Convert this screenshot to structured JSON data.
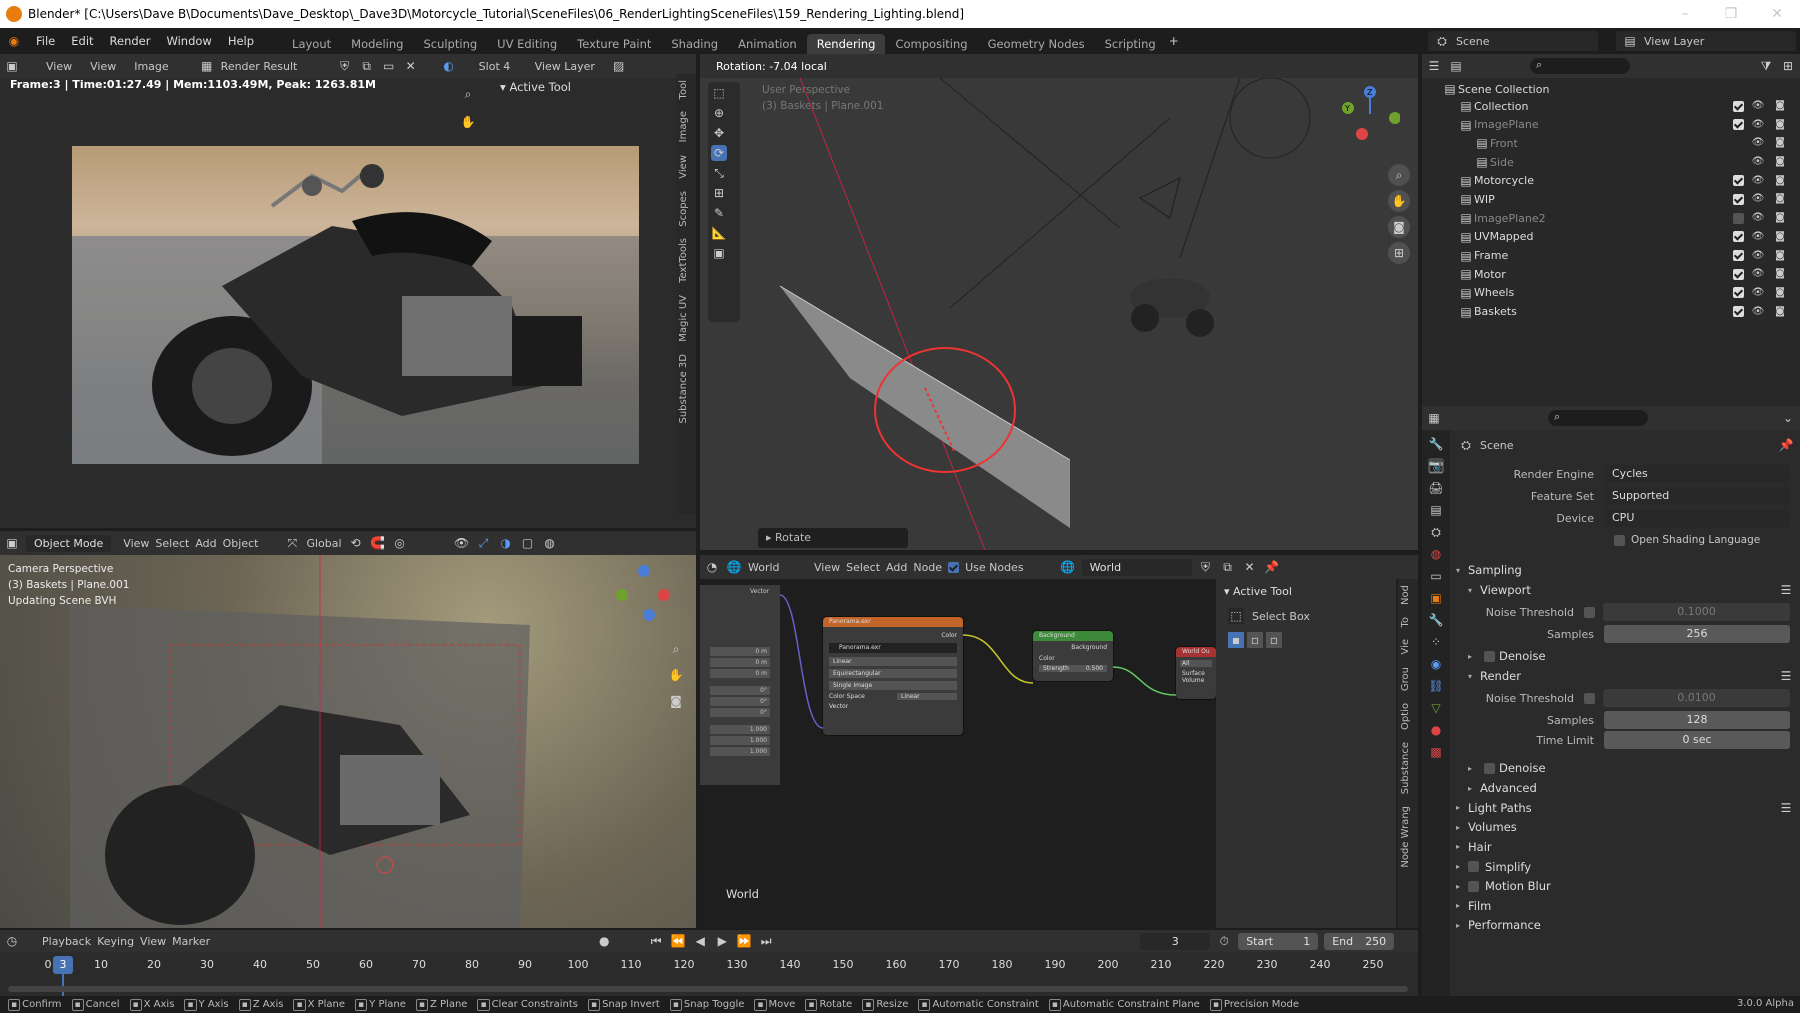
{
  "window": {
    "title": "Blender* [C:\\Users\\Dave B\\Documents\\Dave_Desktop\\_Dave3D\\Motorcycle_Tutorial\\SceneFiles\\06_RenderLightingSceneFiles\\159_Rendering_Lighting.blend]"
  },
  "menu": [
    "File",
    "Edit",
    "Render",
    "Window",
    "Help"
  ],
  "workspaces": [
    {
      "label": "Layout",
      "active": false
    },
    {
      "label": "Modeling",
      "active": false
    },
    {
      "label": "Sculpting",
      "active": false
    },
    {
      "label": "UV Editing",
      "active": false
    },
    {
      "label": "Texture Paint",
      "active": false
    },
    {
      "label": "Shading",
      "active": false
    },
    {
      "label": "Animation",
      "active": false
    },
    {
      "label": "Rendering",
      "active": true
    },
    {
      "label": "Compositing",
      "active": false
    },
    {
      "label": "Geometry Nodes",
      "active": false
    },
    {
      "label": "Scripting",
      "active": false
    }
  ],
  "top_right": {
    "scene": "Scene",
    "view_layer": "View Layer"
  },
  "image_editor": {
    "menu": [
      "View",
      "View",
      "Image"
    ],
    "image_name": "Render Result",
    "slot": "Slot 4",
    "view_layer": "View Layer",
    "info": "Frame:3 | Time:01:27.49 | Mem:1103.49M, Peak: 1263.81M",
    "active_tool": "Active Tool",
    "tabs": [
      "Tool",
      "Image",
      "View",
      "Scopes",
      "TextTools",
      "Magic UV",
      "Substance 3D"
    ]
  },
  "viewport_top": {
    "header": "Rotation: -7.04 local",
    "label1": "User Perspective",
    "label2": "(3) Baskets | Plane.001",
    "operator": "Rotate"
  },
  "viewport_bottom": {
    "mode": "Object Mode",
    "menu": [
      "View",
      "Select",
      "Add",
      "Object"
    ],
    "orientation": "Global",
    "label1": "Camera Perspective",
    "label2": "(3) Baskets | Plane.001",
    "label3": "Updating Scene BVH"
  },
  "node_editor": {
    "type": "World",
    "menu": [
      "View",
      "Select",
      "Add",
      "Node"
    ],
    "use_nodes": "Use Nodes",
    "world_name": "World",
    "footer_label": "World",
    "active_tool": "Active Tool",
    "select_box": "Select Box",
    "tabs": [
      "Nod",
      "To",
      "Vie",
      "Grou",
      "Optio",
      "Substance",
      "Node Wrang"
    ],
    "node_env": {
      "title": "Panorama.exr",
      "image": "Panorama.exr",
      "interp": "Linear",
      "proj": "Equirectangular",
      "src": "Single Image",
      "cs_label": "Color Space",
      "cs": "Linear",
      "out": "Color",
      "in": "Vector"
    },
    "node_bg": {
      "title": "Background",
      "out": "Background",
      "in1": "Color",
      "in2": "Strength",
      "strength": "0.500"
    },
    "node_out": {
      "title": "World Ou",
      "target": "All",
      "in1": "Surface",
      "in2": "Volume"
    },
    "mapping_vals": [
      "0 m",
      "0 m",
      "0 m",
      "0°",
      "0°",
      "0°",
      "1.000",
      "1.000",
      "1.000"
    ],
    "mapping_out": "Vector"
  },
  "outliner": {
    "root": "Scene Collection",
    "items": [
      {
        "label": "Collection",
        "indent": 1,
        "checked": true,
        "dim": false
      },
      {
        "label": "ImagePlane",
        "indent": 1,
        "checked": true,
        "dim": true
      },
      {
        "label": "Front",
        "indent": 2,
        "checked": null,
        "dim": true
      },
      {
        "label": "Side",
        "indent": 2,
        "checked": null,
        "dim": true
      },
      {
        "label": "Motorcycle",
        "indent": 1,
        "checked": true,
        "dim": false
      },
      {
        "label": "WIP",
        "indent": 1,
        "checked": true,
        "dim": false
      },
      {
        "label": "ImagePlane2",
        "indent": 1,
        "checked": false,
        "dim": true
      },
      {
        "label": "UVMapped",
        "indent": 1,
        "checked": true,
        "dim": false
      },
      {
        "label": "Frame",
        "indent": 1,
        "checked": true,
        "dim": false
      },
      {
        "label": "Motor",
        "indent": 1,
        "checked": true,
        "dim": false
      },
      {
        "label": "Wheels",
        "indent": 1,
        "checked": true,
        "dim": false
      },
      {
        "label": "Baskets",
        "indent": 1,
        "checked": true,
        "dim": false
      }
    ]
  },
  "properties": {
    "context": "Scene",
    "render_engine_label": "Render Engine",
    "render_engine": "Cycles",
    "feature_set_label": "Feature Set",
    "feature_set": "Supported",
    "device_label": "Device",
    "device": "CPU",
    "osl": "Open Shading Language",
    "sampling": "Sampling",
    "viewport": "Viewport",
    "noise_threshold_label": "Noise Threshold",
    "vp_noise": "0.1000",
    "samples_label": "Samples",
    "vp_samples": "256",
    "denoise": "Denoise",
    "render": "Render",
    "r_noise": "0.0100",
    "r_samples": "128",
    "time_limit_label": "Time Limit",
    "time_limit": "0 sec",
    "advanced": "Advanced",
    "sections": [
      "Light Paths",
      "Volumes",
      "Hair",
      "Simplify",
      "Motion Blur",
      "Film",
      "Performance"
    ]
  },
  "timeline": {
    "menu": [
      "Playback",
      "Keying",
      "View",
      "Marker"
    ],
    "current_frame": "3",
    "start_label": "Start",
    "start": "1",
    "end_label": "End",
    "end": "250",
    "ticks": [
      "0",
      "10",
      "20",
      "30",
      "40",
      "50",
      "60",
      "70",
      "80",
      "90",
      "100",
      "110",
      "120",
      "130",
      "140",
      "150",
      "160",
      "170",
      "180",
      "190",
      "200",
      "210",
      "220",
      "230",
      "240",
      "250"
    ]
  },
  "status": {
    "items": [
      "Confirm",
      "Cancel",
      "X Axis",
      "Y Axis",
      "Z Axis",
      "X Plane",
      "Y Plane",
      "Z Plane",
      "Clear Constraints",
      "Snap Invert",
      "Snap Toggle",
      "Move",
      "Rotate",
      "Resize",
      "Automatic Constraint",
      "Automatic Constraint Plane",
      "Precision Mode"
    ],
    "version": "3.0.0 Alpha"
  }
}
